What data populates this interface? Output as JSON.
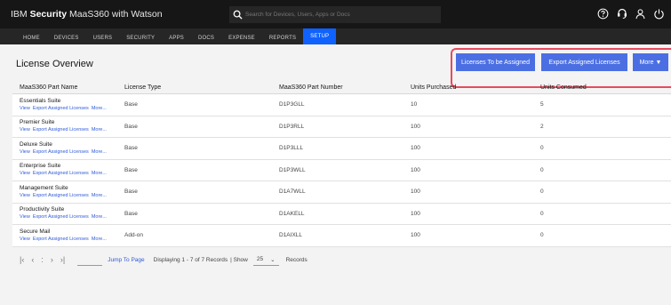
{
  "header": {
    "brand_prefix": "IBM",
    "brand_bold": "Security",
    "brand_suffix": "MaaS360 with Watson",
    "search_placeholder": "Search for Devices, Users, Apps or Docs",
    "icons": [
      "help-icon",
      "support-icon",
      "user-icon",
      "power-icon"
    ]
  },
  "nav": {
    "items": [
      {
        "label": "HOME"
      },
      {
        "label": "DEVICES"
      },
      {
        "label": "USERS"
      },
      {
        "label": "SECURITY"
      },
      {
        "label": "APPS"
      },
      {
        "label": "DOCS"
      },
      {
        "label": "EXPENSE"
      },
      {
        "label": "REPORTS"
      },
      {
        "label": "SETUP"
      }
    ],
    "active": "SETUP"
  },
  "page": {
    "title": "License Overview",
    "buttons": {
      "assign": "Licenses To be Assigned",
      "export": "Export Assigned Licenses",
      "more": "More ▼"
    }
  },
  "table": {
    "headers": [
      "MaaS360 Part Name",
      "License Type",
      "MaaS360 Part Number",
      "Units Purchased",
      "Units Consumed"
    ],
    "link_labels": [
      "View",
      "Export Assigned Licenses",
      "More..."
    ],
    "rows": [
      {
        "name": "Essentials Suite",
        "type": "Base",
        "part": "D1P3GLL",
        "purchased": "10",
        "consumed": "5"
      },
      {
        "name": "Premier Suite",
        "type": "Base",
        "part": "D1P3RLL",
        "purchased": "100",
        "consumed": "2"
      },
      {
        "name": "Deluxe Suite",
        "type": "Base",
        "part": "D1P3LLL",
        "purchased": "100",
        "consumed": "0"
      },
      {
        "name": "Enterprise Suite",
        "type": "Base",
        "part": "D1P3WLL",
        "purchased": "100",
        "consumed": "0"
      },
      {
        "name": "Management Suite",
        "type": "Base",
        "part": "D1A7WLL",
        "purchased": "100",
        "consumed": "0"
      },
      {
        "name": "Productivity Suite",
        "type": "Base",
        "part": "D1AKELL",
        "purchased": "100",
        "consumed": "0"
      },
      {
        "name": "Secure Mail",
        "type": "Add-on",
        "part": "D1AIXLL",
        "purchased": "100",
        "consumed": "0"
      }
    ]
  },
  "pager": {
    "jump_label": "Jump To Page",
    "display_text": "Displaying 1 - 7 of 7 Records",
    "show_label": "| Show",
    "page_size": "25",
    "records_label": "Records"
  }
}
